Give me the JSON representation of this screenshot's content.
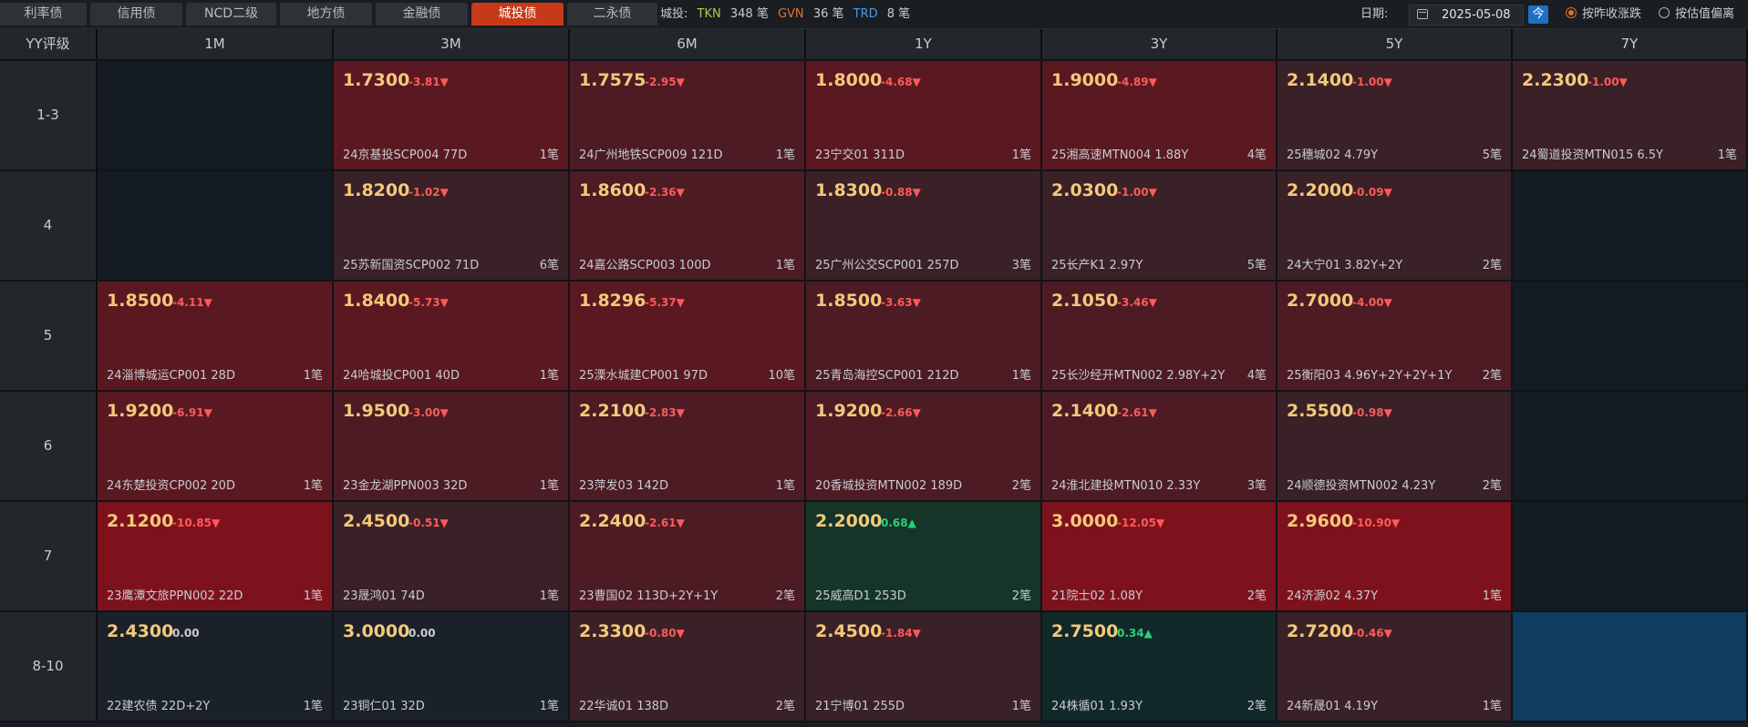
{
  "tabs": [
    {
      "label": "利率债",
      "active": false
    },
    {
      "label": "信用债",
      "active": false
    },
    {
      "label": "NCD二级",
      "active": false
    },
    {
      "label": "地方债",
      "active": false
    },
    {
      "label": "金融债",
      "active": false
    },
    {
      "label": "城投债",
      "active": true
    },
    {
      "label": "二永债",
      "active": false
    }
  ],
  "stats": {
    "label": "城投:",
    "tkn_label": "TKN",
    "tkn_count": "348 笔",
    "gvn_label": "GVN",
    "gvn_count": "36 笔",
    "trd_label": "TRD",
    "trd_count": "8 笔"
  },
  "controls": {
    "date_label": "日期:",
    "date_value": "2025-05-08",
    "today_label": "今",
    "radio1_label": "按昨收涨跌",
    "radio1_checked": true,
    "radio2_label": "按估值偏离",
    "radio2_checked": false
  },
  "header": [
    "YY评级",
    "1M",
    "3M",
    "6M",
    "1Y",
    "3Y",
    "5Y",
    "7Y"
  ],
  "colors": {
    "empty": "#141b22",
    "empty_highlight": "#0f3c61",
    "red1": "#3a2027",
    "red2": "#4d1b24",
    "red3": "#5a1921",
    "red4": "#7e121c",
    "green": "#143528",
    "green_dark": "#12292a",
    "neutral": "#1b2129"
  },
  "rows": [
    {
      "rating": "1-3",
      "cells": [
        null,
        {
          "yield": "1.7300",
          "change": "-3.81▼",
          "dir": "down",
          "bond": "24京基投SCP004 77D",
          "count": "1笔",
          "shade": "red3"
        },
        {
          "yield": "1.7575",
          "change": "-2.95▼",
          "dir": "down",
          "bond": "24广州地铁SCP009 121D",
          "count": "1笔",
          "shade": "red2"
        },
        {
          "yield": "1.8000",
          "change": "-4.68▼",
          "dir": "down",
          "bond": "23宁交01 311D",
          "count": "1笔",
          "shade": "red3"
        },
        {
          "yield": "1.9000",
          "change": "-4.89▼",
          "dir": "down",
          "bond": "25湘高速MTN004 1.88Y",
          "count": "4笔",
          "shade": "red3"
        },
        {
          "yield": "2.1400",
          "change": "-1.00▼",
          "dir": "down",
          "bond": "25穗城02 4.79Y",
          "count": "5笔",
          "shade": "red1"
        },
        {
          "yield": "2.2300",
          "change": "-1.00▼",
          "dir": "down",
          "bond": "24蜀道投资MTN015 6.5Y",
          "count": "1笔",
          "shade": "red1"
        }
      ]
    },
    {
      "rating": "4",
      "cells": [
        null,
        {
          "yield": "1.8200",
          "change": "-1.02▼",
          "dir": "down",
          "bond": "25苏新国资SCP002 71D",
          "count": "6笔",
          "shade": "red1"
        },
        {
          "yield": "1.8600",
          "change": "-2.36▼",
          "dir": "down",
          "bond": "24嘉公路SCP003 100D",
          "count": "1笔",
          "shade": "red2"
        },
        {
          "yield": "1.8300",
          "change": "-0.88▼",
          "dir": "down",
          "bond": "25广州公交SCP001 257D",
          "count": "3笔",
          "shade": "red1"
        },
        {
          "yield": "2.0300",
          "change": "-1.00▼",
          "dir": "down",
          "bond": "25长产K1 2.97Y",
          "count": "5笔",
          "shade": "red1"
        },
        {
          "yield": "2.2000",
          "change": "-0.09▼",
          "dir": "down",
          "bond": "24大宁01 3.82Y+2Y",
          "count": "2笔",
          "shade": "red1"
        },
        null
      ]
    },
    {
      "rating": "5",
      "cells": [
        {
          "yield": "1.8500",
          "change": "-4.11▼",
          "dir": "down",
          "bond": "24淄博城运CP001 28D",
          "count": "1笔",
          "shade": "red3"
        },
        {
          "yield": "1.8400",
          "change": "-5.73▼",
          "dir": "down",
          "bond": "24哈城投CP001 40D",
          "count": "1笔",
          "shade": "red3"
        },
        {
          "yield": "1.8296",
          "change": "-5.37▼",
          "dir": "down",
          "bond": "25溧水城建CP001 97D",
          "count": "10笔",
          "shade": "red3"
        },
        {
          "yield": "1.8500",
          "change": "-3.63▼",
          "dir": "down",
          "bond": "25青岛海控SCP001 212D",
          "count": "1笔",
          "shade": "red2"
        },
        {
          "yield": "2.1050",
          "change": "-3.46▼",
          "dir": "down",
          "bond": "25长沙经开MTN002 2.98Y+2Y",
          "count": "4笔",
          "shade": "red2"
        },
        {
          "yield": "2.7000",
          "change": "-4.00▼",
          "dir": "down",
          "bond": "25衡阳03 4.96Y+2Y+2Y+1Y",
          "count": "2笔",
          "shade": "red2"
        },
        null
      ]
    },
    {
      "rating": "6",
      "cells": [
        {
          "yield": "1.9200",
          "change": "-6.91▼",
          "dir": "down",
          "bond": "24东楚投资CP002 20D",
          "count": "1笔",
          "shade": "red3"
        },
        {
          "yield": "1.9500",
          "change": "-3.00▼",
          "dir": "down",
          "bond": "23金龙湖PPN003 32D",
          "count": "1笔",
          "shade": "red2"
        },
        {
          "yield": "2.2100",
          "change": "-2.83▼",
          "dir": "down",
          "bond": "23萍发03 142D",
          "count": "1笔",
          "shade": "red2"
        },
        {
          "yield": "1.9200",
          "change": "-2.66▼",
          "dir": "down",
          "bond": "20香城投资MTN002 189D",
          "count": "2笔",
          "shade": "red2"
        },
        {
          "yield": "2.1400",
          "change": "-2.61▼",
          "dir": "down",
          "bond": "24淮北建投MTN010 2.33Y",
          "count": "3笔",
          "shade": "red2"
        },
        {
          "yield": "2.5500",
          "change": "-0.98▼",
          "dir": "down",
          "bond": "24顺德投资MTN002 4.23Y",
          "count": "2笔",
          "shade": "red1"
        },
        null
      ]
    },
    {
      "rating": "7",
      "cells": [
        {
          "yield": "2.1200",
          "change": "-10.85▼",
          "dir": "down",
          "bond": "23鹰潭文旅PPN002 22D",
          "count": "1笔",
          "shade": "red4"
        },
        {
          "yield": "2.4500",
          "change": "-0.51▼",
          "dir": "down",
          "bond": "23晟鸿01 74D",
          "count": "1笔",
          "shade": "red1"
        },
        {
          "yield": "2.2400",
          "change": "-2.61▼",
          "dir": "down",
          "bond": "23曹国02 113D+2Y+1Y",
          "count": "2笔",
          "shade": "red2"
        },
        {
          "yield": "2.2000",
          "change": "0.68▲",
          "dir": "up",
          "bond": "25威高D1 253D",
          "count": "2笔",
          "shade": "green"
        },
        {
          "yield": "3.0000",
          "change": "-12.05▼",
          "dir": "down",
          "bond": "21院士02 1.08Y",
          "count": "2笔",
          "shade": "red4"
        },
        {
          "yield": "2.9600",
          "change": "-10.90▼",
          "dir": "down",
          "bond": "24济源02 4.37Y",
          "count": "1笔",
          "shade": "red4"
        },
        null
      ]
    },
    {
      "rating": "8-10",
      "cells": [
        {
          "yield": "2.4300",
          "change": "0.00",
          "dir": "flat",
          "bond": "22建农债 22D+2Y",
          "count": "1笔",
          "shade": "neutral"
        },
        {
          "yield": "3.0000",
          "change": "0.00",
          "dir": "flat",
          "bond": "23铜仁01 32D",
          "count": "1笔",
          "shade": "neutral"
        },
        {
          "yield": "2.3300",
          "change": "-0.80▼",
          "dir": "down",
          "bond": "22华诚01 138D",
          "count": "2笔",
          "shade": "red1"
        },
        {
          "yield": "2.4500",
          "change": "-1.84▼",
          "dir": "down",
          "bond": "21宁博01 255D",
          "count": "1笔",
          "shade": "red1"
        },
        {
          "yield": "2.7500",
          "change": "0.34▲",
          "dir": "up",
          "bond": "24株循01 1.93Y",
          "count": "2笔",
          "shade": "green_dark"
        },
        {
          "yield": "2.7200",
          "change": "-0.46▼",
          "dir": "down",
          "bond": "24新晟01 4.19Y",
          "count": "1笔",
          "shade": "red1"
        },
        "highlight"
      ]
    }
  ]
}
